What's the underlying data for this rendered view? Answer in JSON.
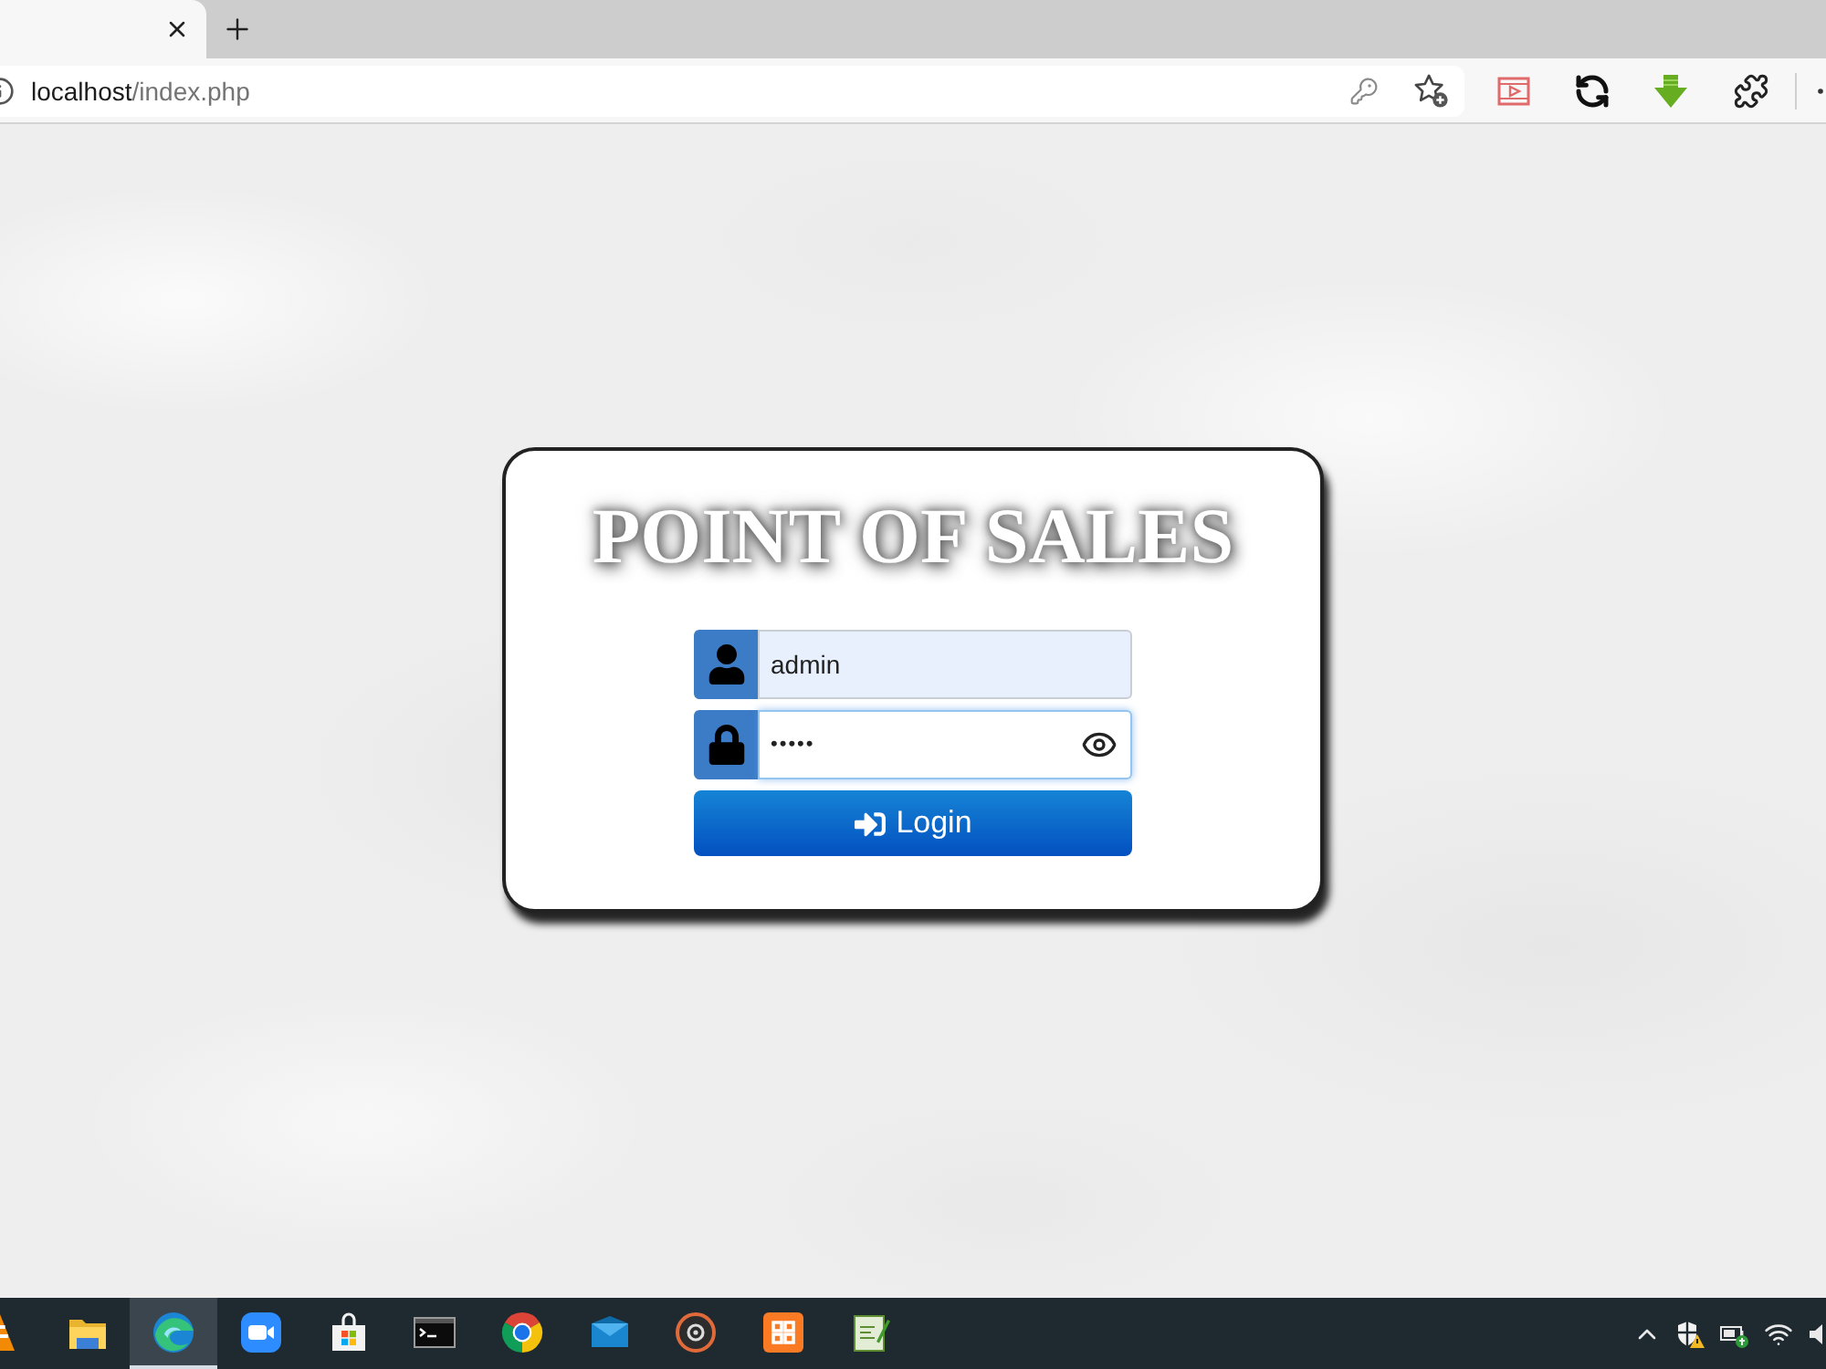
{
  "browser": {
    "tabs": [
      {
        "selected": true
      }
    ],
    "address_bar": {
      "host": "localhost",
      "path": "/index.php"
    }
  },
  "login_card": {
    "title": "POINT OF SALES",
    "fields": [
      {
        "kind": "username",
        "value": "admin",
        "autofilled": true,
        "focused": false
      },
      {
        "kind": "password",
        "value": "•••••",
        "autofilled": false,
        "focused": true
      }
    ],
    "submit_button": "Login"
  },
  "taskbar": {
    "apps": [
      {
        "kind": "cone",
        "selected": false
      },
      {
        "kind": "folder",
        "selected": false
      },
      {
        "kind": "swirl",
        "selected": true
      },
      {
        "kind": "camera",
        "selected": false
      },
      {
        "kind": "bag",
        "selected": false
      },
      {
        "kind": "terminal",
        "selected": false
      },
      {
        "kind": "ring",
        "selected": false
      },
      {
        "kind": "mail",
        "selected": false
      },
      {
        "kind": "disc",
        "selected": false
      },
      {
        "kind": "tile",
        "selected": false
      },
      {
        "kind": "notepad",
        "selected": false
      }
    ]
  }
}
